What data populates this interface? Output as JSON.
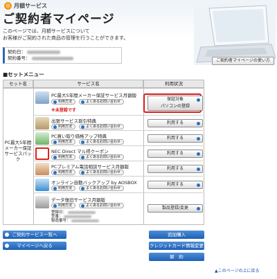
{
  "header": {
    "service_label": "月額サービス",
    "page_title": "ご契約者マイページ",
    "intro_line1": "このページでは、月額サービスについて",
    "intro_line2": "お客様がご契約された商品の管理を行うことができます。",
    "contract_date_label": "契約日：",
    "contract_no_label": "契約番号：",
    "howto_button": "ご契約者マイページの使い方"
  },
  "section_title": "■セットメニュー",
  "table": {
    "col_set": "セット名",
    "col_service": "サービス名",
    "col_status": "利用状況",
    "set_name_lines": [
      "PC最大5年間",
      "メーカー保証",
      "サービスパック"
    ]
  },
  "mini_buttons": {
    "usage": "利用方法",
    "faq": "よくあるお問い合わせ"
  },
  "services": [
    {
      "name": "PC最大5年間メーカー保証サービス月額版",
      "warning": "※未登録です",
      "status": "保証対象\nパソコンの登録"
    },
    {
      "name": "出張サービス割引特典",
      "status": "利用する"
    },
    {
      "name": "PC買い取り価格アップ特典",
      "status": "利用する"
    },
    {
      "name": "NEC Direct マル得クーポン",
      "status": "利用する"
    },
    {
      "name": "PCプレミアム電話相談サービス月額版",
      "status": "利用する"
    },
    {
      "name": "オンライン自動バックアップ by AOSBOX",
      "status": "利用する"
    },
    {
      "name": "データ復旧サービス月額版",
      "status": "製品登録/変更",
      "extra_labels": [
        "登録日：",
        "型番：",
        "製造番号："
      ]
    }
  ],
  "footer_buttons": {
    "contract_list": "ご契約サービス一覧へ",
    "back_mypage": "マイページへ戻る",
    "add_purchase": "追加購入",
    "credit_change": "クレジットカード情報変更",
    "cancel": "解　約"
  },
  "page_top_link": "▲このページの上に戻る",
  "colors": {
    "accent_blue": "#2b67b0",
    "warning_red": "#d71a1a",
    "logo_orange": "#f29b1c"
  }
}
